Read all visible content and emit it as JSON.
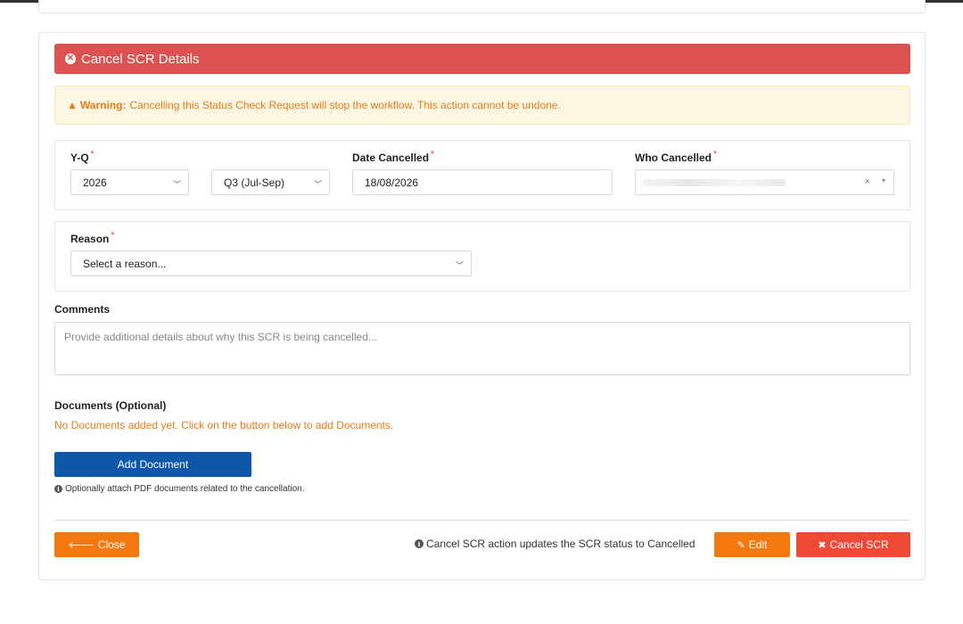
{
  "header": {
    "title": "Cancel SCR Details",
    "icon": "times-circle-icon"
  },
  "warning": {
    "strong": "Warning:",
    "text": "Cancelling this Status Check Request will stop the workflow. This action cannot be undone."
  },
  "form": {
    "yq": {
      "label": "Y-Q",
      "required": "*",
      "year": "2026",
      "quarter": "Q3 (Jul-Sep)"
    },
    "date_cancelled": {
      "label": "Date Cancelled",
      "required": "*",
      "value": "18/08/2026"
    },
    "who_cancelled": {
      "label": "Who Cancelled",
      "required": "*",
      "clear": "×",
      "caret": "▾"
    },
    "reason": {
      "label": "Reason",
      "required": "*",
      "placeholder": "Select a reason..."
    },
    "comments": {
      "label": "Comments",
      "placeholder": "Provide additional details about why this SCR is being cancelled..."
    }
  },
  "documents": {
    "label": "Documents (Optional)",
    "empty_text": "No Documents added yet. Click on the button below to add Documents.",
    "add_label": "Add Document",
    "hint": "Optionally attach PDF documents related to the cancellation."
  },
  "footer": {
    "close_label": "Close",
    "status_note": "Cancel SCR action updates the SCR status to Cancelled",
    "edit_label": "Edit",
    "cancel_label": "Cancel SCR"
  },
  "colors": {
    "danger": "#dc5250",
    "warning_text": "#e87a17",
    "primary": "#0f57a8",
    "orange": "#f5780f",
    "red": "#f04a37"
  }
}
